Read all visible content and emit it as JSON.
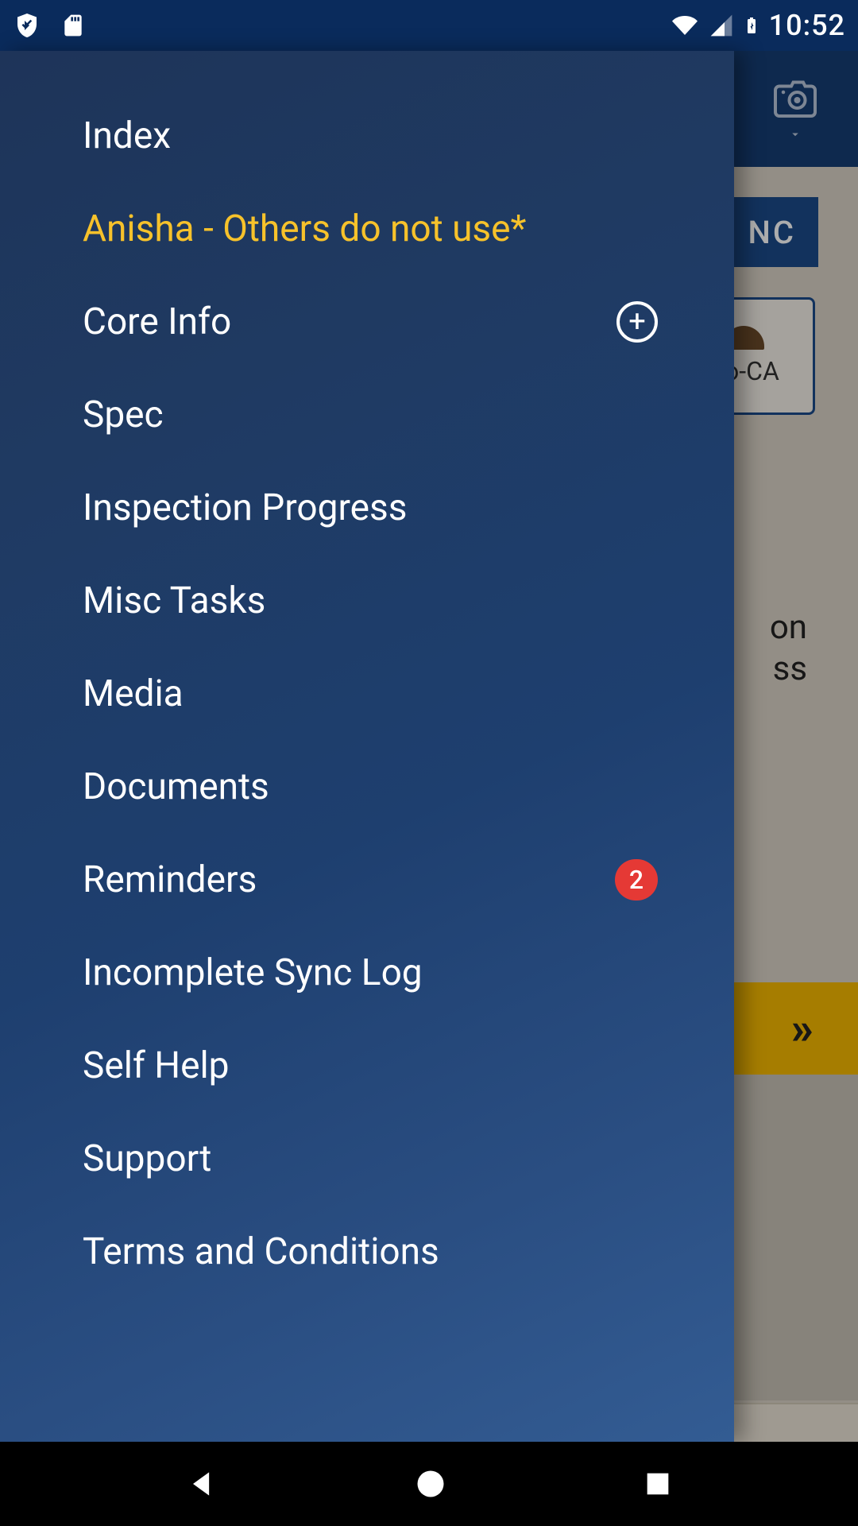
{
  "status": {
    "time": "10:52",
    "icons": [
      "shield",
      "sd-card",
      "wifi",
      "signal",
      "battery-charging"
    ]
  },
  "header": {
    "camera_dropdown": true
  },
  "background": {
    "sync_button": "NC",
    "card_label": "Co-CA",
    "partial_text_line1": "on",
    "partial_text_line2": "ss",
    "yellow_bar_arrow": "»"
  },
  "drawer": {
    "items": [
      {
        "label": "Index",
        "active": false
      },
      {
        "label": "Anisha - Others do not use*",
        "active": true
      },
      {
        "label": "Core Info",
        "active": false,
        "icon": "plus"
      },
      {
        "label": "Spec",
        "active": false
      },
      {
        "label": "Inspection Progress",
        "active": false
      },
      {
        "label": "Misc Tasks",
        "active": false
      },
      {
        "label": "Media",
        "active": false
      },
      {
        "label": "Documents",
        "active": false
      },
      {
        "label": "Reminders",
        "active": false,
        "badge": "2"
      },
      {
        "label": "Incomplete Sync Log",
        "active": false
      },
      {
        "label": "Self Help",
        "active": false
      },
      {
        "label": "Support",
        "active": false
      },
      {
        "label": "Terms and Conditions",
        "active": false
      }
    ]
  }
}
